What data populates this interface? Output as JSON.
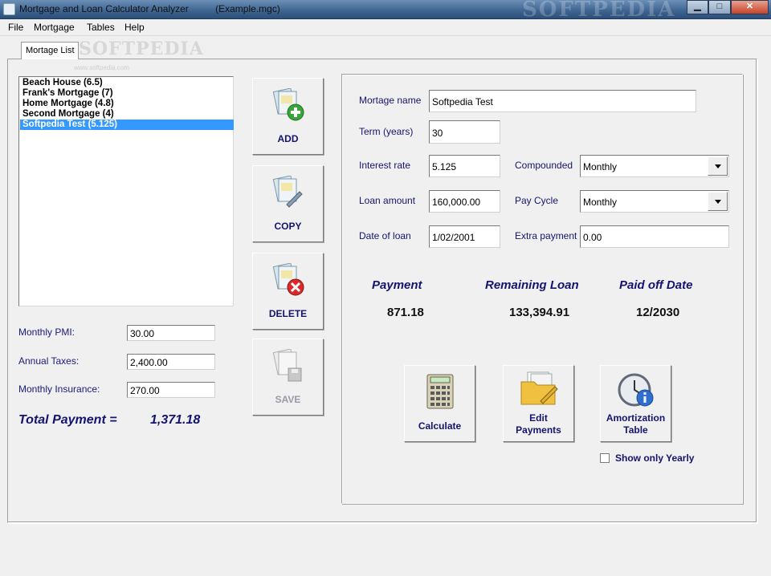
{
  "window": {
    "title": "Mortgage and Loan Calculator Analyzer          (Example.mgc)",
    "watermark": "SOFTPEDIA",
    "minimize_glyph": "▁",
    "maximize_glyph": "□",
    "close_glyph": "✕"
  },
  "menu": [
    "File",
    "Mortgage",
    "Tables",
    "Help"
  ],
  "tab": {
    "label": "Mortage List",
    "watermark": "SOFTPEDIA",
    "url": "www.softpedia.com"
  },
  "mortgage_list": [
    {
      "label": "Beach House (6.5)",
      "selected": false
    },
    {
      "label": "Frank's Mortgage (7)",
      "selected": false
    },
    {
      "label": "Home Mortgage (4.8)",
      "selected": false
    },
    {
      "label": "Second Mortgage (4)",
      "selected": false
    },
    {
      "label": "Softpedia Test (5.125)",
      "selected": true
    }
  ],
  "left_fields": {
    "pmi_label": "Monthly PMI:",
    "pmi_value": "30.00",
    "taxes_label": "Annual Taxes:",
    "taxes_value": "2,400.00",
    "insurance_label": "Monthly Insurance:",
    "insurance_value": "270.00",
    "total_label": "Total Payment =",
    "total_value": "1,371.18"
  },
  "actions": {
    "add": "ADD",
    "copy": "COPY",
    "delete": "DELETE",
    "save": "SAVE"
  },
  "form": {
    "name_label": "Mortage name",
    "name_value": "Softpedia Test",
    "term_label": "Term (years)",
    "term_value": "30",
    "rate_label": "Interest rate",
    "rate_value": "5.125",
    "compounded_label": "Compounded",
    "compounded_value": "Monthly",
    "amount_label": "Loan amount",
    "amount_value": "160,000.00",
    "paycycle_label": "Pay Cycle",
    "paycycle_value": "Monthly",
    "date_label": "Date of loan",
    "date_value": "1/02/2001",
    "extra_label": "Extra payment",
    "extra_value": "0.00"
  },
  "results": {
    "payment_title": "Payment",
    "payment_value": "871.18",
    "remaining_title": "Remaining Loan",
    "remaining_value": "133,394.91",
    "paidoff_title": "Paid off Date",
    "paidoff_value": "12/2030"
  },
  "tools": {
    "calculate": "Calculate",
    "edit_line1": "Edit",
    "edit_line2": "Payments",
    "amort_line1": "Amortization",
    "amort_line2": "Table",
    "show_yearly": "Show only Yearly"
  },
  "colors": {
    "label_navy": "#14146e",
    "selection": "#3399ff",
    "titlebar": "#3d6390"
  }
}
